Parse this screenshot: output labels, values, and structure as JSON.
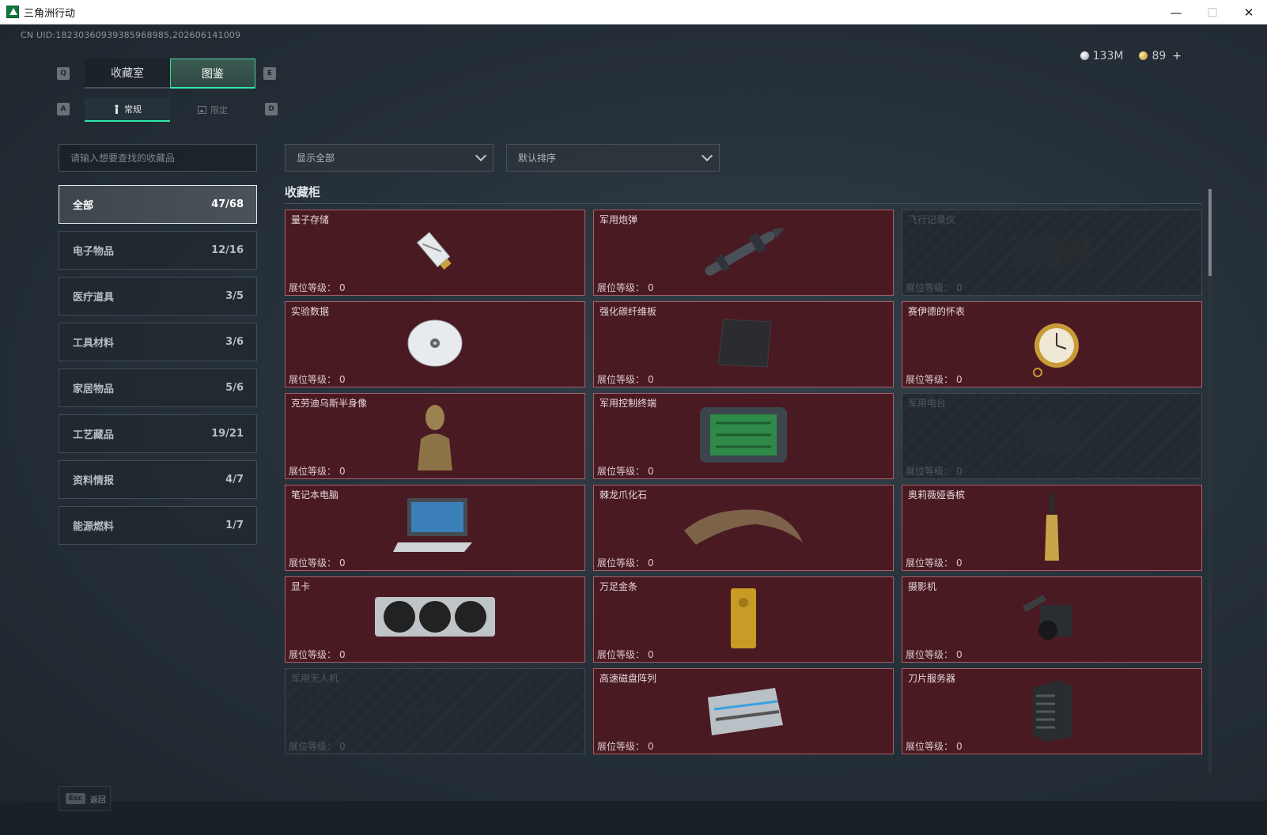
{
  "window": {
    "title": "三角洲行动",
    "minimize": "—",
    "maximize": "☐",
    "close": "✕"
  },
  "uid": "CN UID:18230360939385968985,202606141009",
  "currency": {
    "silver": "133M",
    "gold": "89",
    "plus": "+"
  },
  "keys": {
    "q": "Q",
    "e": "E",
    "a": "A",
    "d": "D"
  },
  "tabs": [
    {
      "label": "收藏室"
    },
    {
      "label": "图鉴"
    }
  ],
  "subtabs": [
    {
      "label": "常规"
    },
    {
      "label": "限定"
    }
  ],
  "search": {
    "placeholder": "请输入想要查找的收藏品"
  },
  "categories": [
    {
      "label": "全部",
      "count": "47/68"
    },
    {
      "label": "电子物品",
      "count": "12/16"
    },
    {
      "label": "医疗道具",
      "count": "3/5"
    },
    {
      "label": "工具材料",
      "count": "3/6"
    },
    {
      "label": "家居物品",
      "count": "5/6"
    },
    {
      "label": "工艺藏品",
      "count": "19/21"
    },
    {
      "label": "资料情报",
      "count": "4/7"
    },
    {
      "label": "能源燃料",
      "count": "1/7"
    }
  ],
  "filters": {
    "display": "显示全部",
    "sort": "默认排序"
  },
  "section_title": "收藏柜",
  "level_label": "展位等级：",
  "items": [
    {
      "name": "量子存储",
      "level": "0",
      "locked": false,
      "icon": "usb-drive"
    },
    {
      "name": "军用炮弹",
      "level": "0",
      "locked": false,
      "icon": "missile"
    },
    {
      "name": "飞行记录仪",
      "level": "0",
      "locked": true,
      "icon": "flight-recorder"
    },
    {
      "name": "实验数据",
      "level": "0",
      "locked": false,
      "icon": "disc"
    },
    {
      "name": "强化碳纤维板",
      "level": "0",
      "locked": false,
      "icon": "carbon-plate"
    },
    {
      "name": "赛伊德的怀表",
      "level": "0",
      "locked": false,
      "icon": "pocket-watch"
    },
    {
      "name": "克劳迪乌斯半身像",
      "level": "0",
      "locked": false,
      "icon": "bust"
    },
    {
      "name": "军用控制终端",
      "level": "0",
      "locked": false,
      "icon": "control-terminal"
    },
    {
      "name": "军用电台",
      "level": "0",
      "locked": true,
      "icon": "radio"
    },
    {
      "name": "笔记本电脑",
      "level": "0",
      "locked": false,
      "icon": "laptop"
    },
    {
      "name": "棘龙爪化石",
      "level": "0",
      "locked": false,
      "icon": "claw-fossil"
    },
    {
      "name": "奥莉薇娅香槟",
      "level": "0",
      "locked": false,
      "icon": "champagne"
    },
    {
      "name": "显卡",
      "level": "0",
      "locked": false,
      "icon": "graphics-card"
    },
    {
      "name": "万足金条",
      "level": "0",
      "locked": false,
      "icon": "gold-bar"
    },
    {
      "name": "摄影机",
      "level": "0",
      "locked": false,
      "icon": "camera"
    },
    {
      "name": "军用无人机",
      "level": "0",
      "locked": true,
      "icon": "drone"
    },
    {
      "name": "高速磁盘阵列",
      "level": "0",
      "locked": false,
      "icon": "disk-array"
    },
    {
      "name": "刀片服务器",
      "level": "0",
      "locked": false,
      "icon": "blade-server"
    }
  ],
  "footer": {
    "key": "Esc",
    "label": "返回"
  }
}
